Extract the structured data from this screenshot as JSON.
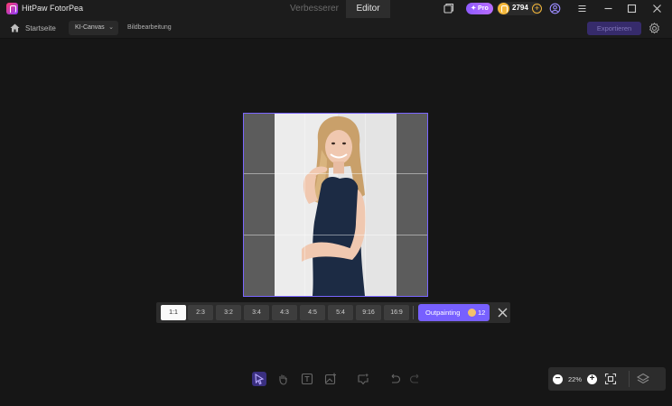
{
  "app": {
    "title": "HitPaw FotorPea"
  },
  "tabs": [
    {
      "label": "Verbesserer"
    },
    {
      "label": "Editor"
    }
  ],
  "account": {
    "pro_label": "✦ Pro",
    "credits": "2794"
  },
  "breadcrumb": {
    "home": "Startseite",
    "canvas": "KI-Canvas",
    "page": "Bildbearbeitung"
  },
  "toolbar": {
    "export_label": "Exportieren"
  },
  "ratios": [
    {
      "label": "1:1",
      "active": true
    },
    {
      "label": "2:3"
    },
    {
      "label": "3:2"
    },
    {
      "label": "3:4"
    },
    {
      "label": "4:3"
    },
    {
      "label": "4:5"
    },
    {
      "label": "5:4"
    },
    {
      "label": "9:16"
    },
    {
      "label": "16:9"
    }
  ],
  "outpainting": {
    "label": "Outpainting",
    "cost": "12"
  },
  "zoom": {
    "level": "22%"
  },
  "colors": {
    "accent": "#7760ff",
    "frame": "#7a66ff",
    "background": "#161616",
    "coin": "#f4b73a"
  }
}
